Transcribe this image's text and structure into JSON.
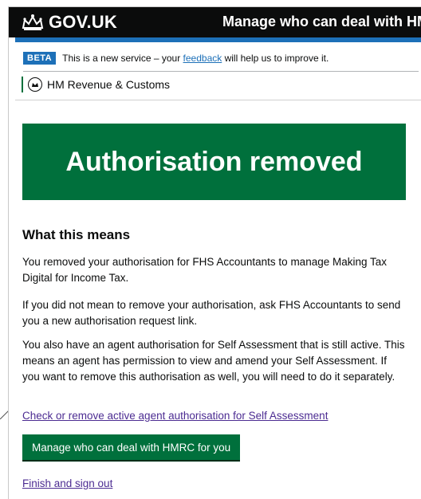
{
  "header": {
    "logo_text": "GOV.UK",
    "service_name": "Manage who can deal with HMRC"
  },
  "phase_banner": {
    "tag": "BETA",
    "text_before": "This is a new service – your",
    "link_text": "feedback",
    "text_after": "will help us to improve it."
  },
  "organisation": {
    "name": "HM Revenue & Customs"
  },
  "confirmation": {
    "title": "Authorisation removed"
  },
  "content": {
    "heading": "What this means",
    "paragraphs": [
      "You removed your authorisation for FHS Accountants to manage Making Tax Digital for Income Tax.",
      "If you did not mean to remove your authorisation, ask FHS Accountants to send you a new authorisation request link.",
      "You also have an agent authorisation for Self Assessment that is still active. This means an agent has permission to view and amend your Self Assessment. If you want to remove this authorisation as well, you will need to do it separately."
    ],
    "check_link": "Check or remove active agent authorisation for Self Assessment",
    "button_label": "Manage who can deal with HMRC for you",
    "finish_link": "Finish and sign out"
  },
  "colors": {
    "header_bg": "#0b0c0c",
    "brand_blue": "#1d70b8",
    "success_green": "#00703c",
    "link_visited": "#4c2c92"
  }
}
